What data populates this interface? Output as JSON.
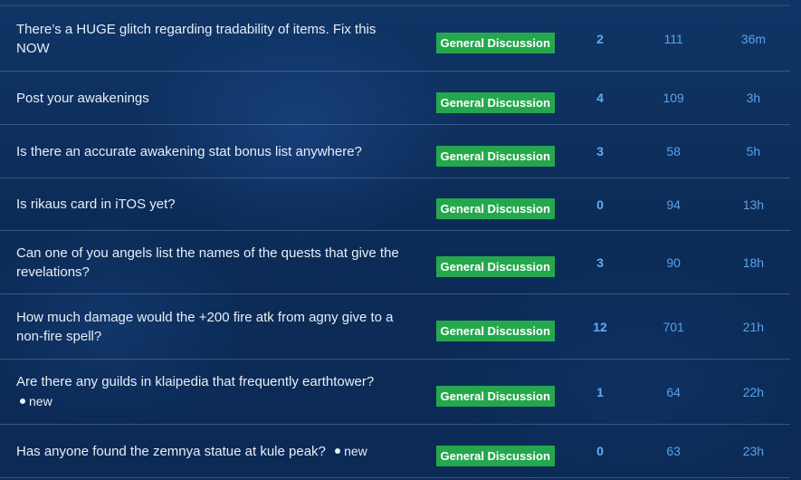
{
  "topics": [
    {
      "title": "There’s a HUGE glitch regarding tradability of items. Fix this NOW",
      "category": "General Discussion",
      "replies": "2",
      "views": "111",
      "activity": "36m",
      "new_label": ""
    },
    {
      "title": "Post your awakenings",
      "category": "General Discussion",
      "replies": "4",
      "views": "109",
      "activity": "3h",
      "new_label": ""
    },
    {
      "title": "Is there an accurate awakening stat bonus list anywhere?",
      "category": "General Discussion",
      "replies": "3",
      "views": "58",
      "activity": "5h",
      "new_label": ""
    },
    {
      "title": "Is rikaus card in iTOS yet?",
      "category": "General Discussion",
      "replies": "0",
      "views": "94",
      "activity": "13h",
      "new_label": ""
    },
    {
      "title": "Can one of you angels list the names of the quests that give the revelations?",
      "category": "General Discussion",
      "replies": "3",
      "views": "90",
      "activity": "18h",
      "new_label": ""
    },
    {
      "title": "How much damage would the +200 fire atk from agny give to a non-fire spell?",
      "category": "General Discussion",
      "replies": "12",
      "views": "701",
      "activity": "21h",
      "new_label": ""
    },
    {
      "title": "Are there any guilds in klaipedia that frequently earthtower?",
      "category": "General Discussion",
      "replies": "1",
      "views": "64",
      "activity": "22h",
      "new_label": "new"
    },
    {
      "title": "Has anyone found the zemnya statue at kule peak?",
      "category": "General Discussion",
      "replies": "0",
      "views": "63",
      "activity": "23h",
      "new_label": "new"
    }
  ]
}
